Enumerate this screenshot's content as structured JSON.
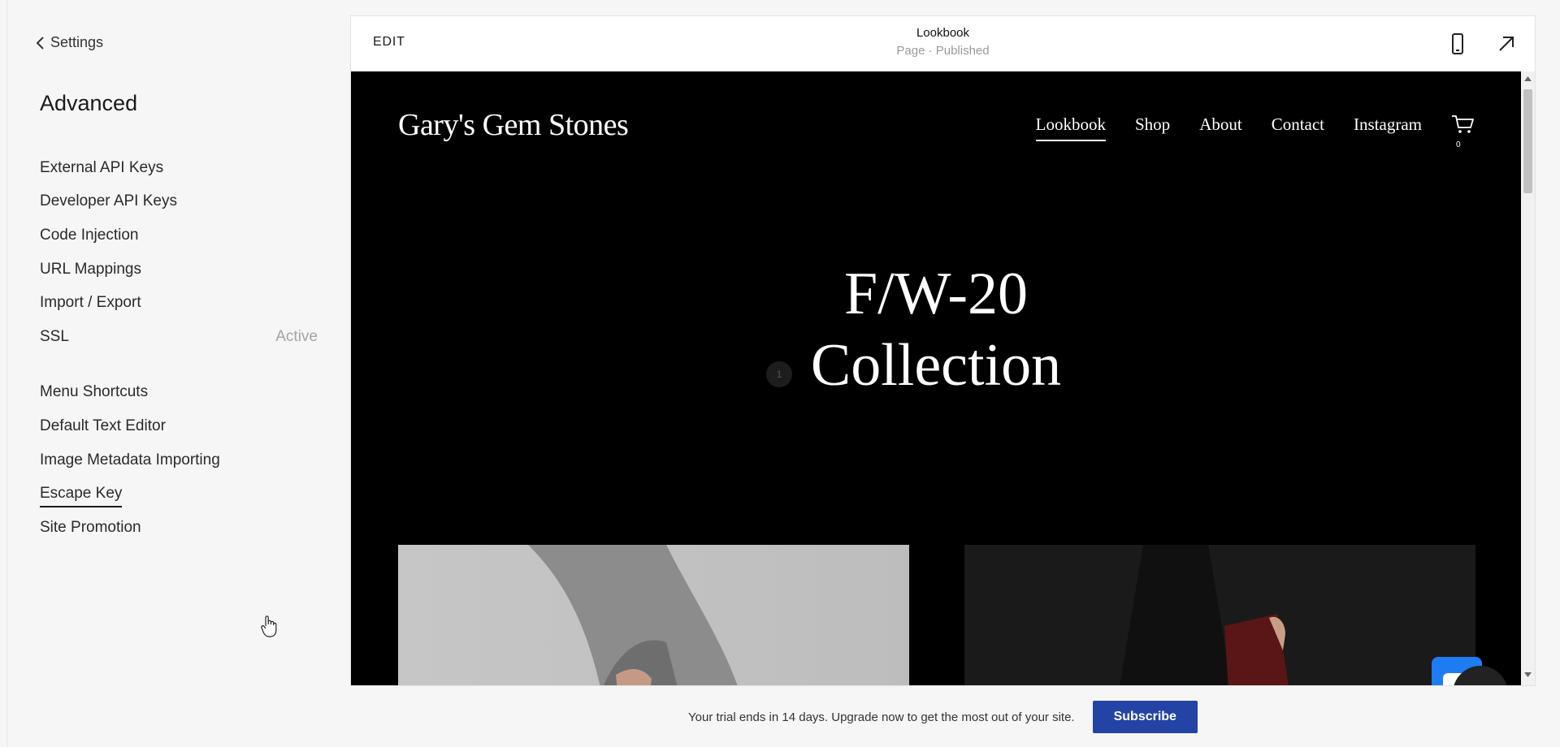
{
  "sidebar": {
    "back_label": "Settings",
    "section_title": "Advanced",
    "group1": [
      {
        "label": "External API Keys",
        "meta": ""
      },
      {
        "label": "Developer API Keys",
        "meta": ""
      },
      {
        "label": "Code Injection",
        "meta": ""
      },
      {
        "label": "URL Mappings",
        "meta": ""
      },
      {
        "label": "Import / Export",
        "meta": ""
      },
      {
        "label": "SSL",
        "meta": "Active"
      }
    ],
    "group2": [
      {
        "label": "Menu Shortcuts"
      },
      {
        "label": "Default Text Editor"
      },
      {
        "label": "Image Metadata Importing"
      },
      {
        "label": "Escape Key"
      },
      {
        "label": "Site Promotion"
      }
    ]
  },
  "preview": {
    "edit_label": "EDIT",
    "page_title": "Lookbook",
    "page_status": "Page · Published",
    "site": {
      "brand": "Gary's Gem Stones",
      "nav": [
        "Lookbook",
        "Shop",
        "About",
        "Contact",
        "Instagram"
      ],
      "cart_count": "0",
      "hero_line1": "F/W-20",
      "hero_line2": "Collection",
      "slide_number": "1"
    },
    "help_label": "?"
  },
  "banner": {
    "message": "Your trial ends in 14 days. Upgrade now to get the most out of your site.",
    "subscribe_label": "Subscribe"
  },
  "colors": {
    "accent": "#2343a5",
    "chat": "#1e7cf2",
    "site_bg": "#000000"
  }
}
